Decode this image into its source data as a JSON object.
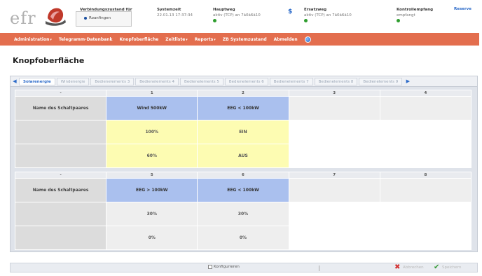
{
  "header": {
    "logo_text": "efr",
    "connection": {
      "title": "Verbindungszustand für",
      "option": "Roanfingen"
    },
    "system_time": {
      "title": "Systemzeit",
      "value": "22.01.13 17:37:34"
    },
    "main_path": {
      "title": "Hauptweg",
      "value": "aktiv (TCP) an 7ã0ã6ã10"
    },
    "alt_path": {
      "title": "Ersatzweg",
      "value": "aktiv (TCP) an 7ã0ã6ã10"
    },
    "control_receive": {
      "title": "Kontrollempfang",
      "value": "empfangt"
    },
    "reserve_label": "Reserve",
    "status_color": "#2e9d2e"
  },
  "menu": [
    {
      "label": "Administration",
      "dropdown": true
    },
    {
      "label": "Telegramm-Datenbank",
      "dropdown": false
    },
    {
      "label": "Knopfoberfläche",
      "dropdown": false
    },
    {
      "label": "Zeitliste",
      "dropdown": true
    },
    {
      "label": "Reports",
      "dropdown": true
    },
    {
      "label": "ZB Systemzustand",
      "dropdown": false
    },
    {
      "label": "Abmelden",
      "dropdown": false
    }
  ],
  "page_title": "Knopfoberfläche",
  "tabs": [
    "Solarenergie",
    "Windenergie",
    "Bedienelements 3",
    "Bedienelements 4",
    "Bedienelements 5",
    "Bedienelements 6",
    "Bedienelements 7",
    "Bedienelements 8",
    "Bedienelements 9"
  ],
  "grid_top": {
    "headers": [
      "-",
      "1",
      "2",
      "3",
      "4"
    ],
    "rows": [
      [
        "Name des Schaltpaares",
        "Wind 500kW",
        "EEG < 100kW",
        "",
        ""
      ],
      [
        "",
        "100%",
        "EIN",
        "",
        ""
      ],
      [
        "",
        "60%",
        "AUS",
        "",
        ""
      ]
    ]
  },
  "grid_bottom": {
    "headers": [
      "-",
      "5",
      "6",
      "7",
      "8"
    ],
    "rows": [
      [
        "Name des Schaltpaares",
        "EEG > 100kW",
        "EEG < 100kW",
        "",
        ""
      ],
      [
        "",
        "30%",
        "30%",
        "",
        ""
      ],
      [
        "",
        "0%",
        "0%",
        "",
        ""
      ]
    ]
  },
  "footer": {
    "configure_label": "Konfigurieren",
    "cancel_label": "Abbrechen",
    "ok_label": "Speichern"
  },
  "colors": {
    "menubar": "#e36e4e",
    "name_cell": "#aac0ee",
    "value_cell_top": "#fdfcb2",
    "value_cell_bottom": "#eeeeee"
  }
}
